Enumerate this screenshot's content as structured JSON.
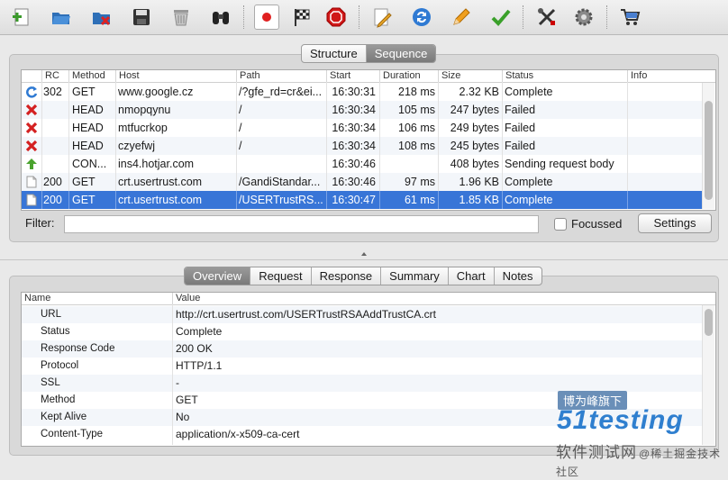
{
  "toolbar": {
    "buttons": [
      {
        "icon": "new-session-icon"
      },
      {
        "icon": "open-folder-icon"
      },
      {
        "icon": "close-session-icon"
      },
      {
        "icon": "save-icon"
      },
      {
        "icon": "trash-icon"
      },
      {
        "icon": "binoculars-icon"
      },
      {
        "icon": "record-icon"
      },
      {
        "icon": "checkered-flag-icon"
      },
      {
        "icon": "stop-icon"
      },
      {
        "icon": "edit-icon"
      },
      {
        "icon": "refresh-icon"
      },
      {
        "icon": "pencil-icon"
      },
      {
        "icon": "validate-check-icon"
      },
      {
        "icon": "tools-icon"
      },
      {
        "icon": "settings-gear-icon"
      },
      {
        "icon": "shopping-cart-icon"
      }
    ]
  },
  "view_tabs": [
    "Structure",
    "Sequence"
  ],
  "view_tabs_active": 1,
  "requests_table": {
    "columns": [
      "RC",
      "Method",
      "Host",
      "Path",
      "Start",
      "Duration",
      "Size",
      "Status",
      "Info"
    ],
    "rows": [
      {
        "icon": "redirect-icon",
        "rc": "302",
        "method": "GET",
        "host": "www.google.cz",
        "path": "/?gfe_rd=cr&ei...",
        "start": "16:30:31",
        "duration": "218 ms",
        "size": "2.32 KB",
        "status": "Complete",
        "info": ""
      },
      {
        "icon": "failed-x-icon",
        "rc": "",
        "method": "HEAD",
        "host": "nmopqynu",
        "path": "/",
        "start": "16:30:34",
        "duration": "105 ms",
        "size": "247 bytes",
        "status": "Failed",
        "info": ""
      },
      {
        "icon": "failed-x-icon",
        "rc": "",
        "method": "HEAD",
        "host": "mtfucrkop",
        "path": "/",
        "start": "16:30:34",
        "duration": "106 ms",
        "size": "249 bytes",
        "status": "Failed",
        "info": ""
      },
      {
        "icon": "failed-x-icon",
        "rc": "",
        "method": "HEAD",
        "host": "czyefwj",
        "path": "/",
        "start": "16:30:34",
        "duration": "108 ms",
        "size": "245 bytes",
        "status": "Failed",
        "info": ""
      },
      {
        "icon": "upload-arrow-icon",
        "rc": "",
        "method": "CON...",
        "host": "ins4.hotjar.com",
        "path": "",
        "start": "16:30:46",
        "duration": "",
        "size": "408 bytes",
        "status": "Sending request body",
        "info": ""
      },
      {
        "icon": "document-icon",
        "rc": "200",
        "method": "GET",
        "host": "crt.usertrust.com",
        "path": "/GandiStandar...",
        "start": "16:30:46",
        "duration": "97 ms",
        "size": "1.96 KB",
        "status": "Complete",
        "info": ""
      },
      {
        "icon": "document-icon",
        "rc": "200",
        "method": "GET",
        "host": "crt.usertrust.com",
        "path": "/USERTrustRS...",
        "start": "16:30:47",
        "duration": "61 ms",
        "size": "1.85 KB",
        "status": "Complete",
        "info": ""
      }
    ],
    "selected_row": 6
  },
  "filter": {
    "label": "Filter:",
    "value": "",
    "focussed_label": "Focussed",
    "focussed_checked": false,
    "settings_label": "Settings"
  },
  "detail_tabs": [
    "Overview",
    "Request",
    "Response",
    "Summary",
    "Chart",
    "Notes"
  ],
  "detail_tabs_active": 0,
  "overview": {
    "columns": [
      "Name",
      "Value"
    ],
    "rows": [
      {
        "name": "URL",
        "value": "http://crt.usertrust.com/USERTrustRSAAddTrustCA.crt"
      },
      {
        "name": "Status",
        "value": "Complete"
      },
      {
        "name": "Response Code",
        "value": "200 OK"
      },
      {
        "name": "Protocol",
        "value": "HTTP/1.1"
      },
      {
        "name": "SSL",
        "value": "-"
      },
      {
        "name": "Method",
        "value": "GET"
      },
      {
        "name": "Kept Alive",
        "value": "No"
      },
      {
        "name": "Content-Type",
        "value": "application/x-x509-ca-cert"
      }
    ]
  },
  "watermark": {
    "line1": "博为峰旗下",
    "line2": "51testing",
    "line3": "软件测试网",
    "line4": "@稀土掘金技术社区"
  }
}
